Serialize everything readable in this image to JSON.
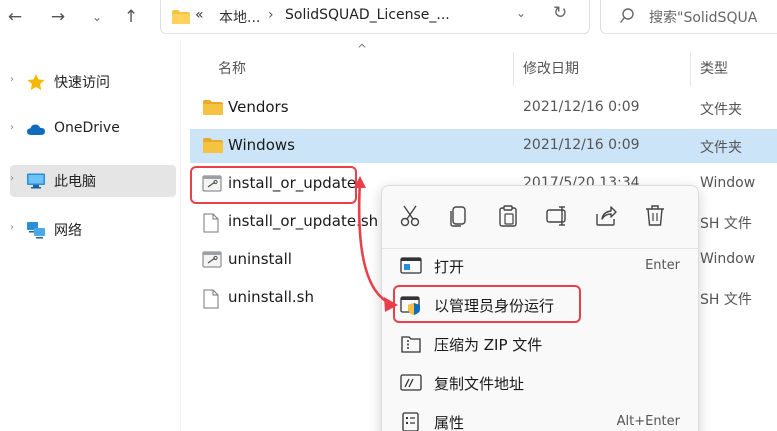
{
  "nav": {
    "back_icon": "arrow-left-icon",
    "forward_icon": "arrow-right-icon",
    "recent_icon": "chevron-down-icon",
    "up_icon": "arrow-up-icon"
  },
  "address": {
    "prefix": "«",
    "location": "本地...",
    "separator": "›",
    "current": "SolidSQUAD_License_..."
  },
  "search": {
    "placeholder": "搜索\"SolidSQUA"
  },
  "sidebar": {
    "items": [
      {
        "label": "快速访问",
        "icon": "star-icon"
      },
      {
        "label": "OneDrive",
        "icon": "cloud-icon"
      },
      {
        "label": "此电脑",
        "icon": "computer-icon",
        "selected": true
      },
      {
        "label": "网络",
        "icon": "network-icon"
      }
    ]
  },
  "columns": {
    "name": "名称",
    "modified": "修改日期",
    "type": "类型"
  },
  "files": [
    {
      "name": "Vendors",
      "date": "2021/12/16 0:09",
      "type": "文件夹",
      "icon": "folder-icon"
    },
    {
      "name": "Windows",
      "date": "2021/12/16 0:09",
      "type": "文件夹",
      "icon": "folder-icon",
      "selected": true
    },
    {
      "name": "install_or_update",
      "date": "2017/5/20 13:34",
      "type": "Window",
      "icon": "script-file-icon"
    },
    {
      "name": "install_or_update.sh",
      "date": "",
      "type": "SH 文件",
      "icon": "file-icon"
    },
    {
      "name": "uninstall",
      "date": "",
      "type": "Window",
      "icon": "script-file-icon"
    },
    {
      "name": "uninstall.sh",
      "date": "",
      "type": "SH 文件",
      "icon": "file-icon"
    }
  ],
  "context_menu": {
    "toolbar": [
      "cut-icon",
      "copy-icon",
      "paste-icon",
      "rename-icon",
      "share-icon",
      "delete-icon"
    ],
    "items": [
      {
        "label": "打开",
        "shortcut": "Enter",
        "icon": "open-icon"
      },
      {
        "label": "以管理员身份运行",
        "shortcut": "",
        "icon": "run-as-admin-icon"
      },
      {
        "label": "压缩为 ZIP 文件",
        "shortcut": "",
        "icon": "zip-icon"
      },
      {
        "label": "复制文件地址",
        "shortcut": "",
        "icon": "copy-path-icon"
      },
      {
        "label": "属性",
        "shortcut": "Alt+Enter",
        "icon": "properties-icon"
      }
    ]
  },
  "colors": {
    "highlight": "#e8404a",
    "selection": "#cce4f7",
    "folder": "#f5c242",
    "onedrive": "#0f6cbd"
  }
}
